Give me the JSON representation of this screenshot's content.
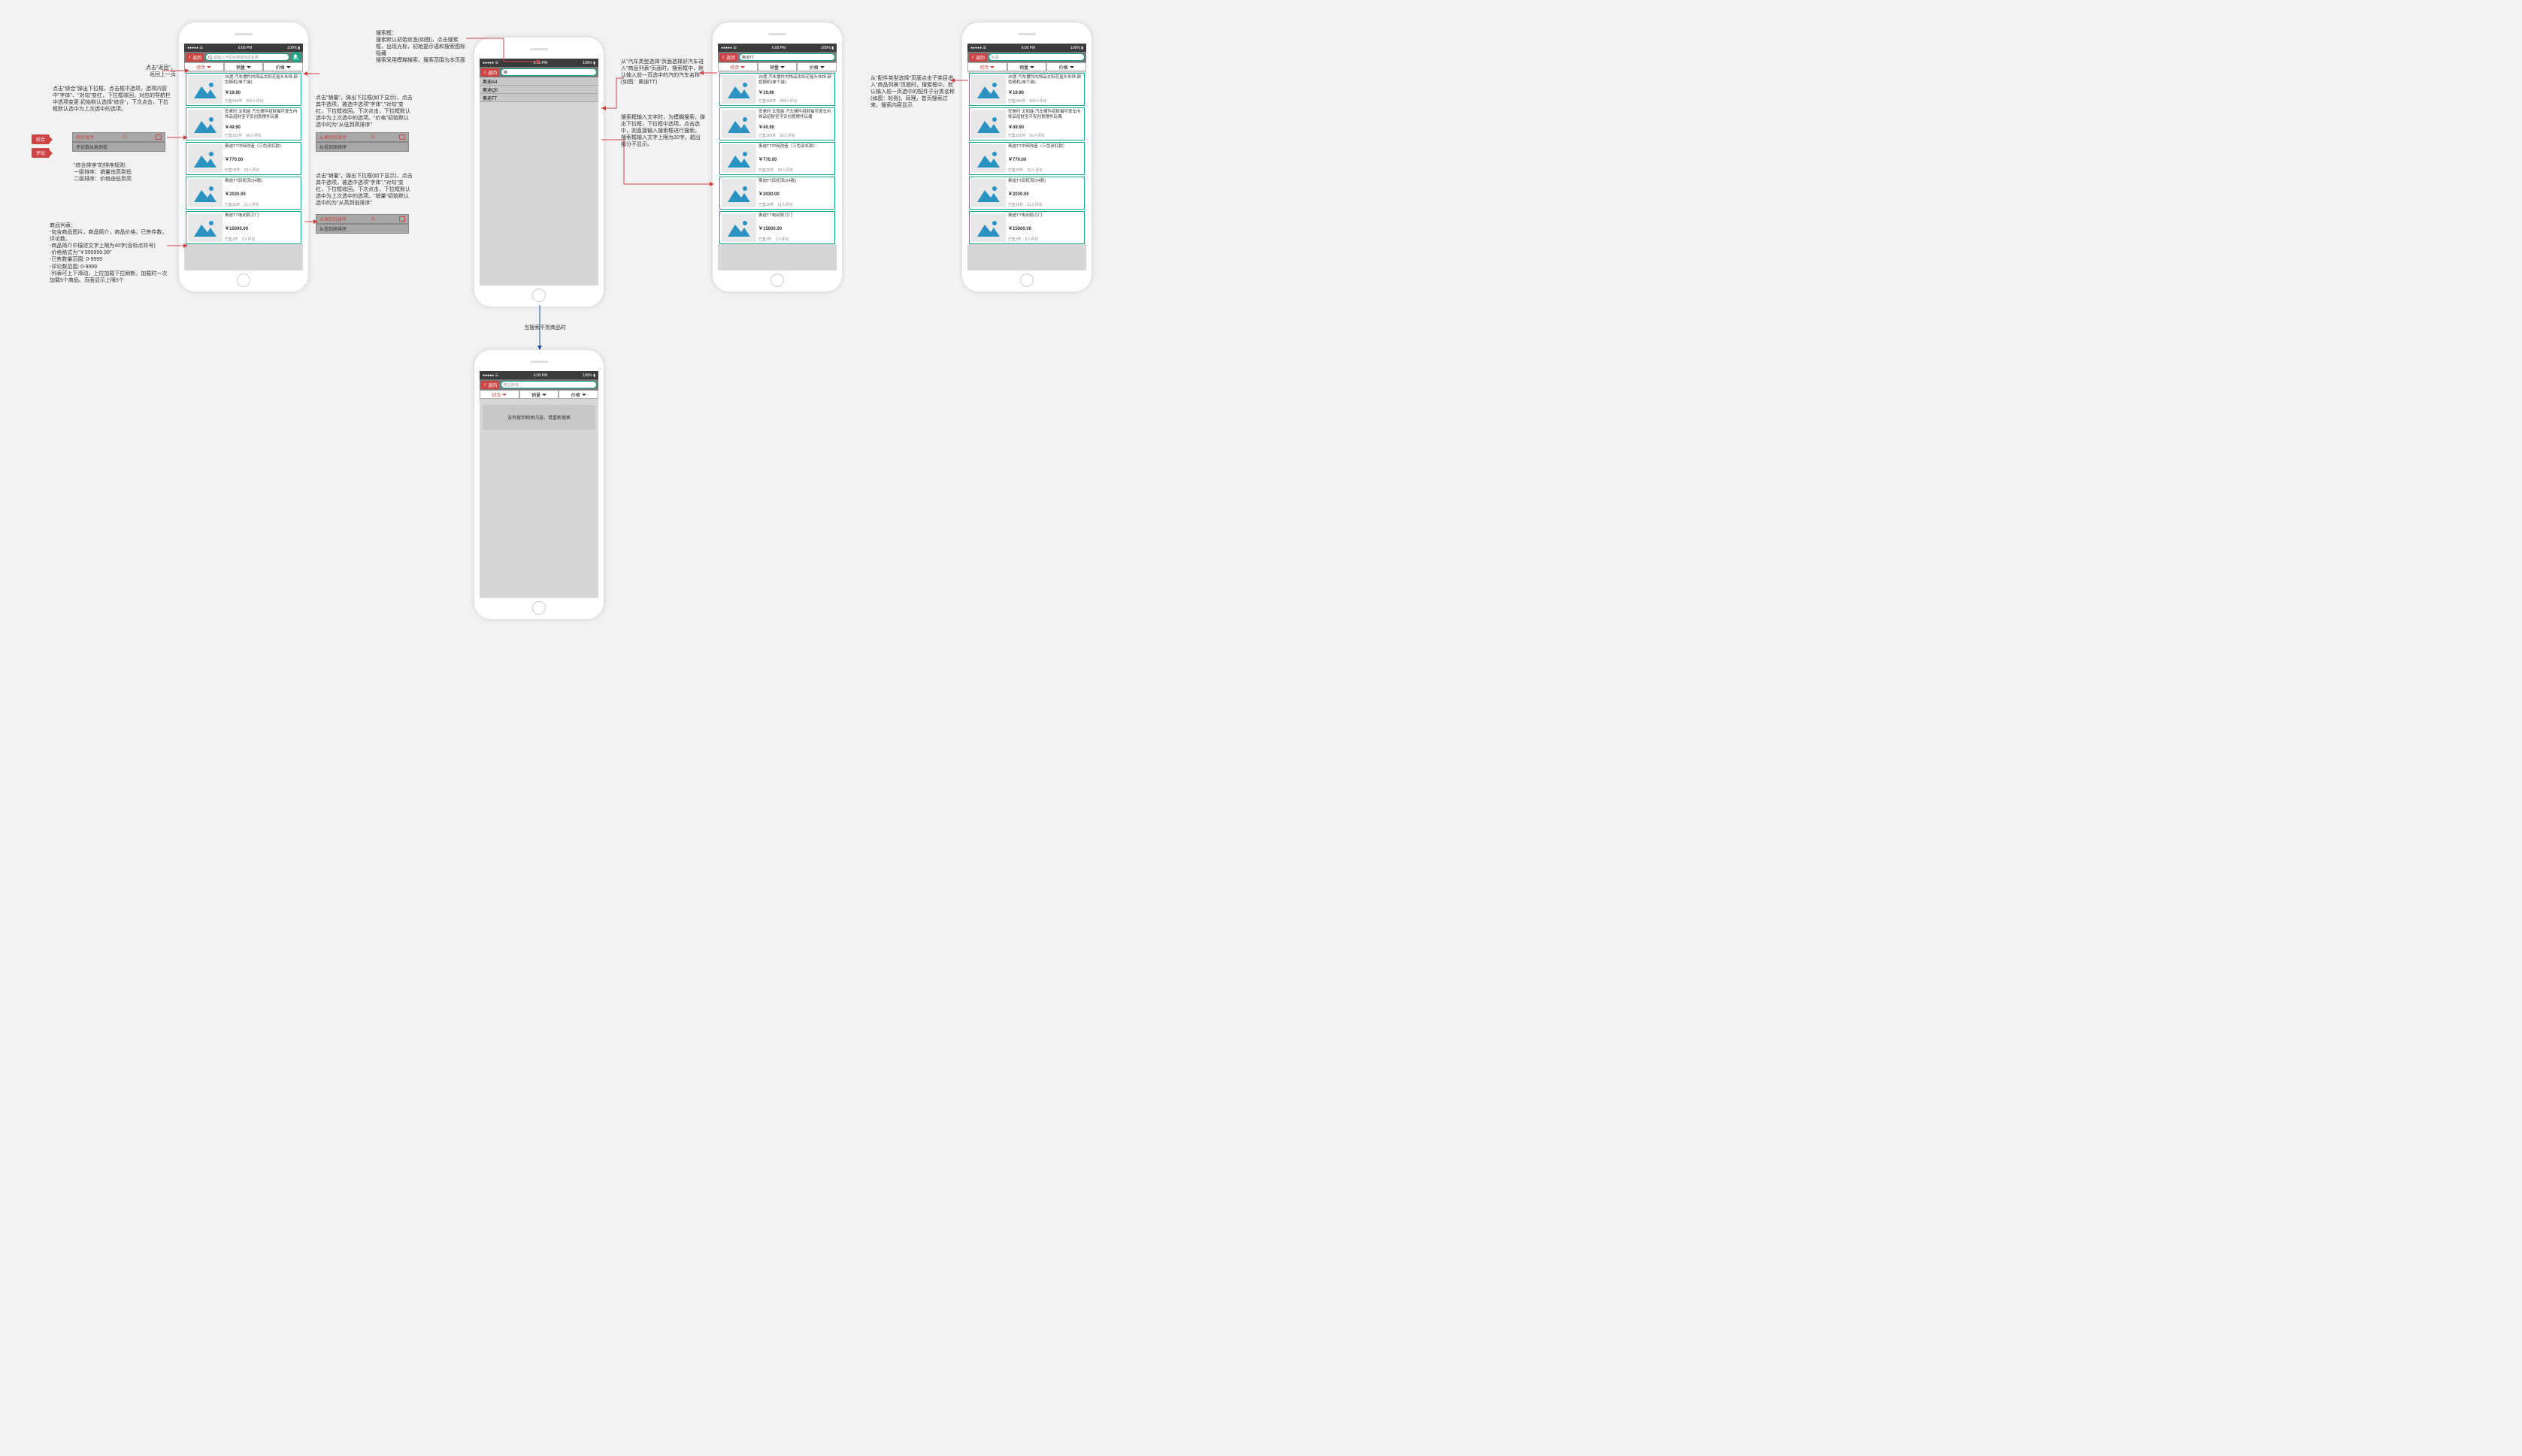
{
  "status": {
    "carrier": "●●●●● ☰",
    "time": "6:00 PM",
    "battery": "100% ▮"
  },
  "nav": {
    "back": "返回"
  },
  "search": {
    "placeholder": "请输入汽车名称或商品名称",
    "confirm": "确认",
    "typed": "奥",
    "result_car": "奥迪TT",
    "result_part": "轮毂",
    "no_result_query": "奥古斯塔"
  },
  "tabs": {
    "comprehensive": "综合",
    "sales": "销量",
    "price": "价格"
  },
  "dropdown_comprehensive": {
    "opt1": "综合排序",
    "opt2": "评论数从高到低"
  },
  "dropdown_sales": {
    "opt1": "从高到低排序",
    "opt2": "从低到高排序"
  },
  "suggestions": {
    "s1": "奥迪A4",
    "s2": "奥迪Q5",
    "s3": "奥迪TT"
  },
  "products": {
    "p1": {
      "title": "26度 汽车摆件内饰品太阳花摇头车饰 颜色随机(单个装)",
      "price": "￥19.90",
      "stats": "已售560件　500人评论"
    },
    "p2": {
      "title": "安美时 太阳能 汽车摆件招财猫可爱车内饰品招财宝平安创意摆件玩偶",
      "price": "￥49.90",
      "stats": "已售102件　56人评论"
    },
    "p3": {
      "title": "奥迪TT中网改造（三色双杠款）",
      "price": "￥770.00",
      "stats": "已售35件　30人评论"
    },
    "p4": {
      "title": "奥迪TT后扰流(S4款)",
      "price": "￥2030.00",
      "stats": "已售16件　11人评论"
    },
    "p5": {
      "title": "奥迪TT电动剪刀门",
      "price": "￥15000.00",
      "stats": "已售2件　2人评论"
    }
  },
  "empty": {
    "msg": "没有搜到相关内容，请重新搜索"
  },
  "tags": {
    "comprehensive": "综合",
    "comments": "评论"
  },
  "annotations": {
    "back_note": "点击\"返回\"，\n返回上一页",
    "comprehensive_note": "点击\"综合\"弹出下拉框，点击框中选项，选项内容中\"字体\"、\"对勾\"变红，下拉框收回，对应的导航栏中选项变更.初始默认选择\"综合\"，下次点击，下拉框默认选中为上次选中的选项。",
    "sort_rule": "\"综合排序\"的排序规则：\n一级排序：销量由高到低\n二级排序：价格由低到高",
    "list_note": "商品列表：\n-包含商品图片，商品简介，商品价格，已售件数，评论数。\n-商品简介中描述文字上限为40字(含标点符号)\n-价格格式为\"￥999999.99\"\n-已售数量范围: 0-9999\n-评论数范围: 0-9999\n-列表可上下滑动，上拉加载下拉刷新。加载时一次加载5个商品。页面显示上限5个",
    "search_note": "搜索框：\n搜索默认初始状态(如图)，点击搜索框，出现光标，初始提示语和搜索图标隐藏\n搜索采用模糊搜索，搜索范围为本页面",
    "sales_note": "点击\"销量\"，弹出下拉框(如下显示)，点击其中选项，被选中选项\"字体\",\"对勾\"变红，下拉框收回。下次点击，下拉框默认选中为上次选中的选项。\"价格\"初始默认选中的为\"从低到高排序\"",
    "sales_note2": "点击\"销量\"，弹出下拉框(如下显示)，点击其中选项，被选中选项\"字体\",\"对勾\"变红，下拉框收回。下次点击，下拉框默认选中为上次选中的选项。\"销量\"初始默认选中的为\"从高到低排序\"",
    "car_select_note": "从\"汽车类型选择\"页面选择好汽车进入\"商品列表\"页面时，搜索框中，默认输入前一页选中的汽的汽车名称(如图：奥迪TT)",
    "fuzzy_note": "搜索框输入文字时，为模糊搜索，弹出下拉框，下拉框中选项，点击选中，则直接输入搜索框进行搜索。\n搜索框输入文字上限为20字，超出部分不显示。",
    "part_note": "从\"配件类型选择\"页面点击子类目进入\"商品列表\"页面时，搜索框中，默认输入前一页选中的配件子分类名称(如图：轮毂)。同理，首页搜索过来，搜索内容显示",
    "no_result_note": "当搜索不到商品时"
  }
}
